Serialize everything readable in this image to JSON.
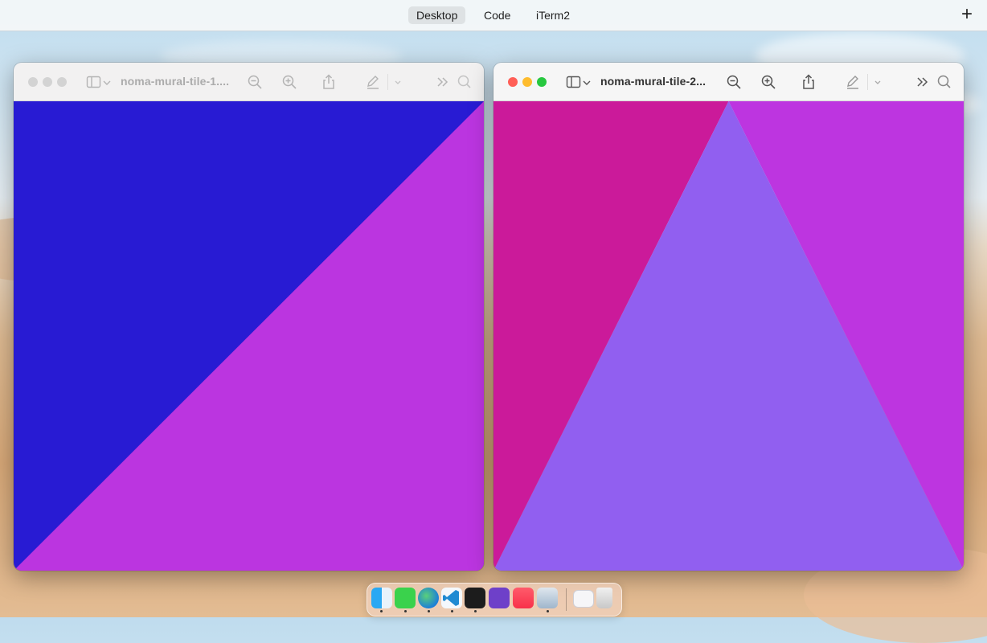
{
  "spaces_bar": {
    "tabs": [
      {
        "label": "Desktop",
        "active": true
      },
      {
        "label": "Code",
        "active": false
      },
      {
        "label": "iTerm2",
        "active": false
      }
    ],
    "add_label": "+"
  },
  "windows": [
    {
      "title": "noma-mural-tile-1....",
      "state": "inactive",
      "artwork": {
        "colors": {
          "upper_left": "#281bd3",
          "lower_right": "#bb35e0"
        }
      }
    },
    {
      "title": "noma-mural-tile-2...",
      "state": "active",
      "artwork": {
        "colors": {
          "left": "#cb1a9a",
          "right": "#bd35e0",
          "triangle": "#915ff0"
        }
      }
    }
  ],
  "toolbar_icons": [
    "sidebar-icon",
    "chevron-down-icon",
    "zoom-out-icon",
    "zoom-in-icon",
    "share-icon",
    "markup-pen-icon",
    "chevron-down-icon",
    "more-chevrons-icon",
    "search-icon"
  ],
  "dock": {
    "apps": [
      {
        "name": "finder-icon",
        "running": true
      },
      {
        "name": "messages-icon",
        "running": true
      },
      {
        "name": "edge-icon",
        "running": true
      },
      {
        "name": "vscode-icon",
        "running": true
      },
      {
        "name": "terminal-icon",
        "running": true
      },
      {
        "name": "github-desktop-icon",
        "running": false
      },
      {
        "name": "music-icon",
        "running": false
      },
      {
        "name": "preview-icon",
        "running": true
      },
      {
        "name": "downloads-stack-icon",
        "running": false
      },
      {
        "name": "trash-icon",
        "running": false
      }
    ]
  }
}
